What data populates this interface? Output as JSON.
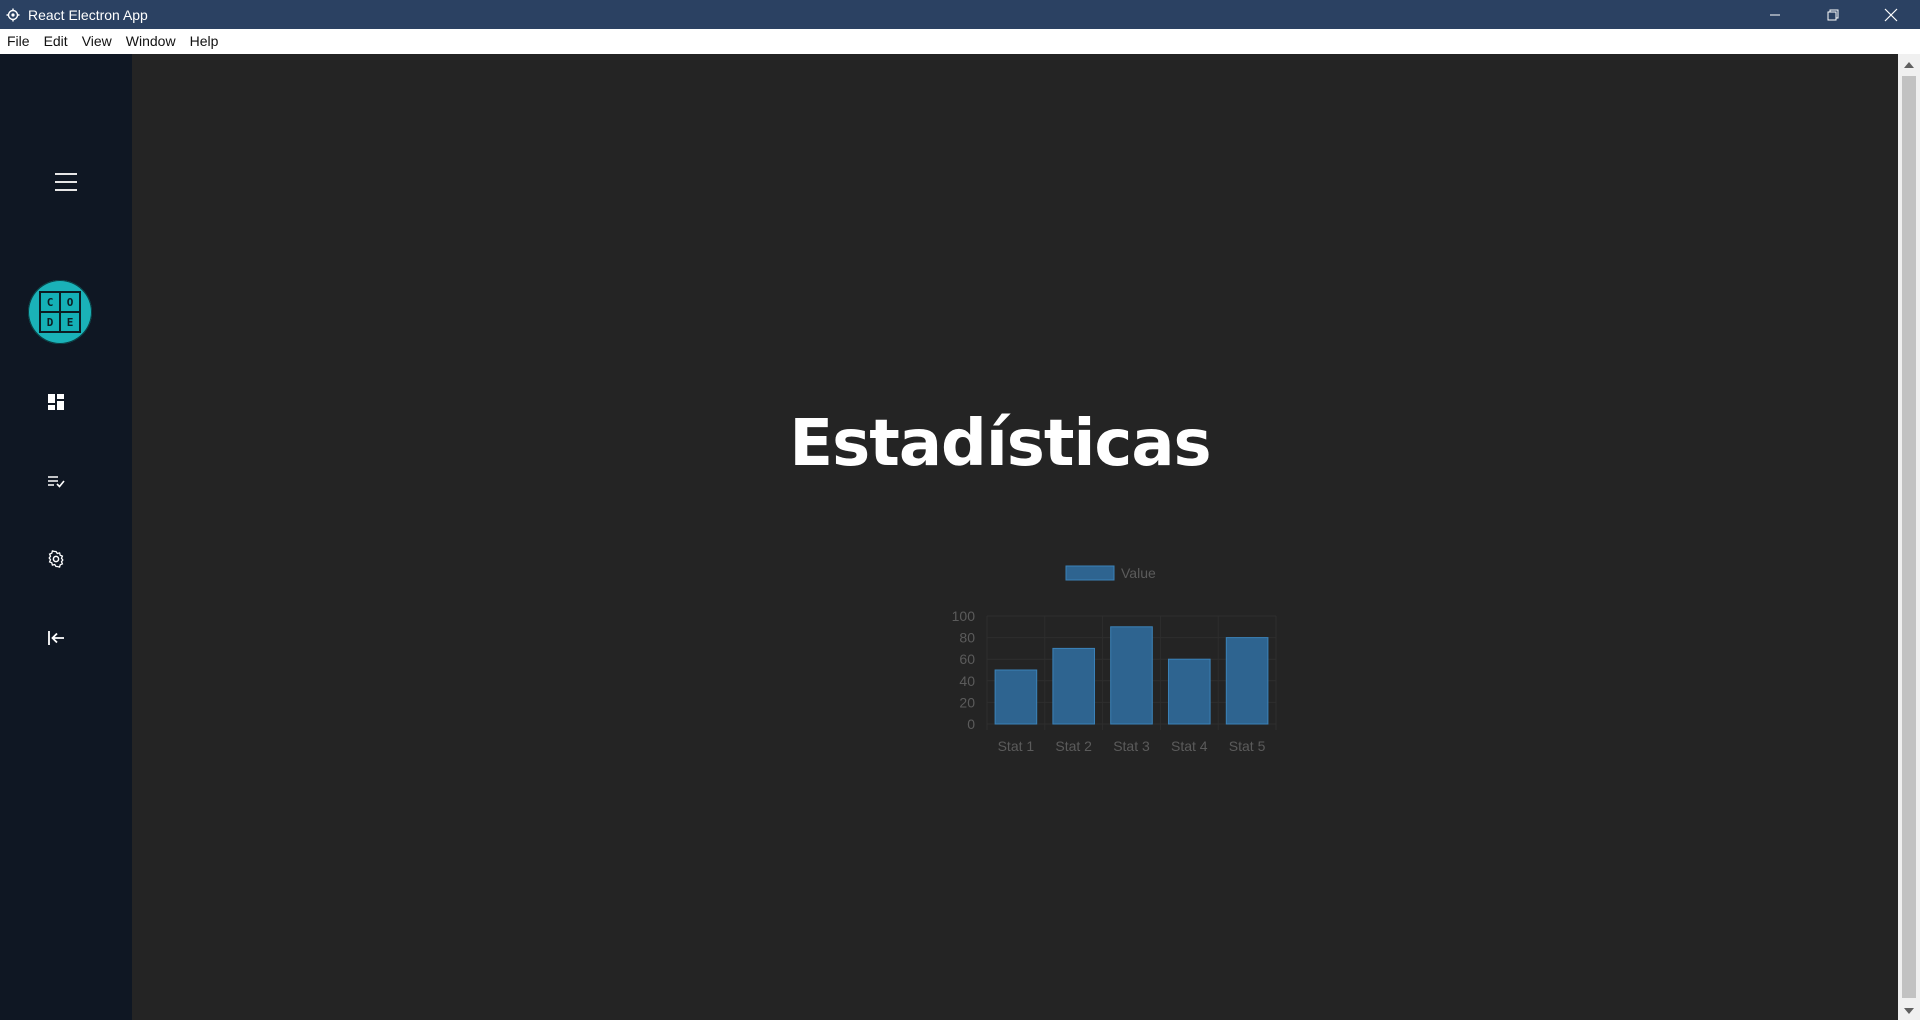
{
  "window": {
    "title": "React Electron App",
    "controls": {
      "minimize": "minimize-icon",
      "restore": "restore-icon",
      "close": "close-icon"
    }
  },
  "menubar": {
    "items": [
      "File",
      "Edit",
      "View",
      "Window",
      "Help"
    ]
  },
  "sidebar": {
    "avatar_letters": [
      "C",
      "O",
      "D",
      "E"
    ],
    "icons": [
      "menu-icon",
      "dashboard-icon",
      "task-list-icon",
      "gear-icon",
      "logout-icon"
    ],
    "background": "#0f1723"
  },
  "main": {
    "title": "Estadísticas",
    "background": "#242424"
  },
  "chart_data": {
    "type": "bar",
    "categories": [
      "Stat 1",
      "Stat 2",
      "Stat 3",
      "Stat 4",
      "Stat 5"
    ],
    "series": [
      {
        "name": "Value",
        "values": [
          50,
          70,
          90,
          60,
          80
        ]
      }
    ],
    "yticks": [
      "0",
      "20",
      "40",
      "60",
      "80",
      "100"
    ],
    "ylim": [
      0,
      100
    ],
    "legend": "top-center",
    "grid": true,
    "colors": {
      "bar_fill": "#2e6490",
      "bar_stroke": "#3b82b8",
      "text": "#5b5b5b",
      "grid": "#2e2e2e"
    }
  }
}
